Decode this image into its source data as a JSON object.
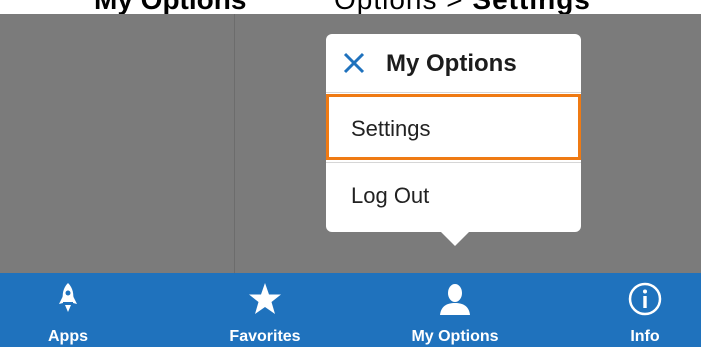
{
  "top_banner": {
    "left_text": "My Options",
    "right_text_prefix": "Options",
    "right_text_bold": "Settings"
  },
  "popup": {
    "title": "My Options",
    "items": [
      {
        "label": "Settings",
        "highlighted": true
      },
      {
        "label": "Log Out",
        "highlighted": false
      }
    ]
  },
  "tabbar": {
    "tabs": [
      {
        "label": "Apps",
        "icon": "rocket-icon"
      },
      {
        "label": "Favorites",
        "icon": "star-icon"
      },
      {
        "label": "My Options",
        "icon": "person-icon"
      },
      {
        "label": "Info",
        "icon": "info-icon"
      }
    ]
  },
  "colors": {
    "background": "#7b7b7b",
    "tabbar": "#1f72bd",
    "highlight": "#ef7a13",
    "close_icon": "#1f72bd"
  }
}
